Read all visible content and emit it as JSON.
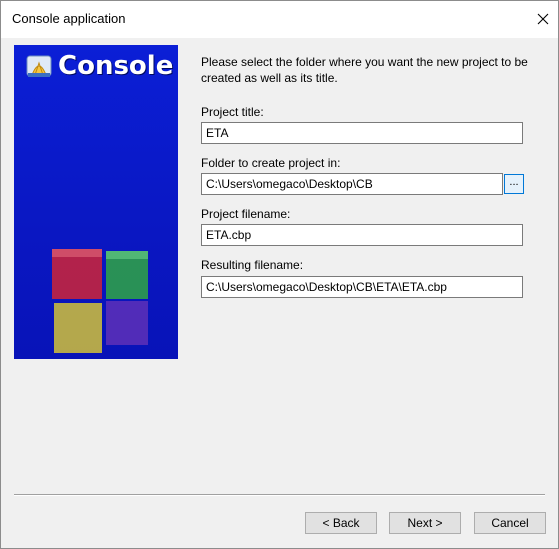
{
  "window": {
    "title": "Console application"
  },
  "banner": {
    "logo_text": "Console"
  },
  "form": {
    "description": "Please select the folder where you want the new project to be created as well as its title.",
    "project_title_label": "Project title:",
    "project_title_value": "ETA",
    "folder_label": "Folder to create project in:",
    "folder_value": "C:\\Users\\omegaco\\Desktop\\CB",
    "browse_label": "...",
    "filename_label": "Project filename:",
    "filename_value": "ETA.cbp",
    "resulting_label": "Resulting filename:",
    "resulting_value": "C:\\Users\\omegaco\\Desktop\\CB\\ETA\\ETA.cbp"
  },
  "buttons": {
    "back": "< Back",
    "next": "Next >",
    "cancel": "Cancel"
  },
  "icons": {
    "close": "close-icon",
    "app": "codeblocks-icon"
  },
  "colors": {
    "banner_blue": "#0b1fd6",
    "accent": "#0078d7"
  }
}
